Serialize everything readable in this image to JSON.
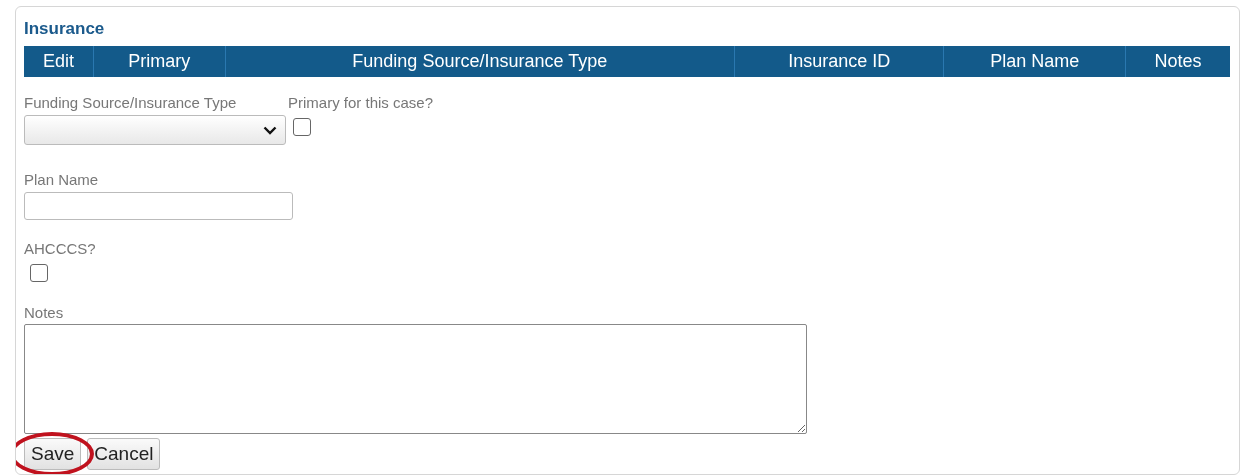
{
  "section_title": "Insurance",
  "table": {
    "columns": [
      {
        "label": "Edit"
      },
      {
        "label": "Primary"
      },
      {
        "label": "Funding Source/Insurance Type"
      },
      {
        "label": "Insurance ID"
      },
      {
        "label": "Plan Name"
      },
      {
        "label": "Notes"
      }
    ]
  },
  "form": {
    "funding_source": {
      "label": "Funding Source/Insurance Type"
    },
    "primary": {
      "label": "Primary for this case?",
      "checked": false
    },
    "plan_name": {
      "label": "Plan Name"
    },
    "ahcccs": {
      "label": "AHCCCS?",
      "checked": false
    },
    "notes": {
      "label": "Notes"
    }
  },
  "buttons": [
    {
      "label": "Save",
      "circled": true
    },
    {
      "label": "Cancel",
      "circled": false
    }
  ]
}
